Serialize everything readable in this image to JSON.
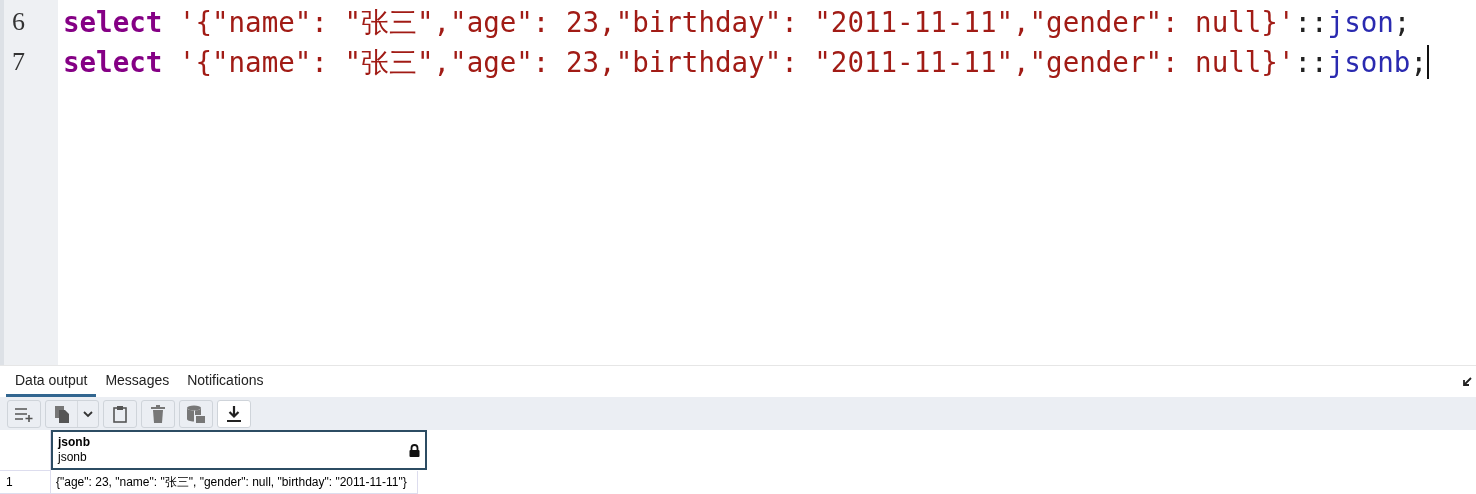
{
  "editor": {
    "lines": [
      {
        "number": "6",
        "tokens": [
          {
            "kind": "keyword",
            "text": "select"
          },
          {
            "kind": "string",
            "text": "'{\"name\": \"张三\",\"age\": 23,\"birthday\": \"2011-11-11\",\"gender\": null}'"
          },
          {
            "kind": "operator",
            "text": "::"
          },
          {
            "kind": "type",
            "text": "json"
          },
          {
            "kind": "operator",
            "text": ";"
          }
        ]
      },
      {
        "number": "7",
        "tokens": [
          {
            "kind": "keyword",
            "text": "select"
          },
          {
            "kind": "string",
            "text": "'{\"name\": \"张三\",\"age\": 23,\"birthday\": \"2011-11-11\",\"gender\": null}'"
          },
          {
            "kind": "operator",
            "text": "::"
          },
          {
            "kind": "type",
            "text": "jsonb"
          },
          {
            "kind": "operator",
            "text": ";"
          }
        ]
      }
    ]
  },
  "tabs": [
    {
      "label": "Data output",
      "selected": true
    },
    {
      "label": "Messages",
      "selected": false
    },
    {
      "label": "Notifications",
      "selected": false
    }
  ],
  "toolbar": [
    {
      "kind": "add-row"
    },
    {
      "kind": "copy"
    },
    {
      "kind": "dropdown"
    },
    {
      "kind": "paste"
    },
    {
      "kind": "delete"
    },
    {
      "kind": "save-data"
    },
    {
      "kind": "download"
    }
  ],
  "grid": {
    "columns": [
      {
        "name": "jsonb",
        "type": "jsonb",
        "locked": true,
        "selected": true
      }
    ],
    "rows": [
      {
        "number": "1",
        "cells": [
          "{\"age\": 23, \"name\": \"张三\", \"gender\": null, \"birthday\": \"2011-11-11\"}"
        ]
      }
    ]
  }
}
